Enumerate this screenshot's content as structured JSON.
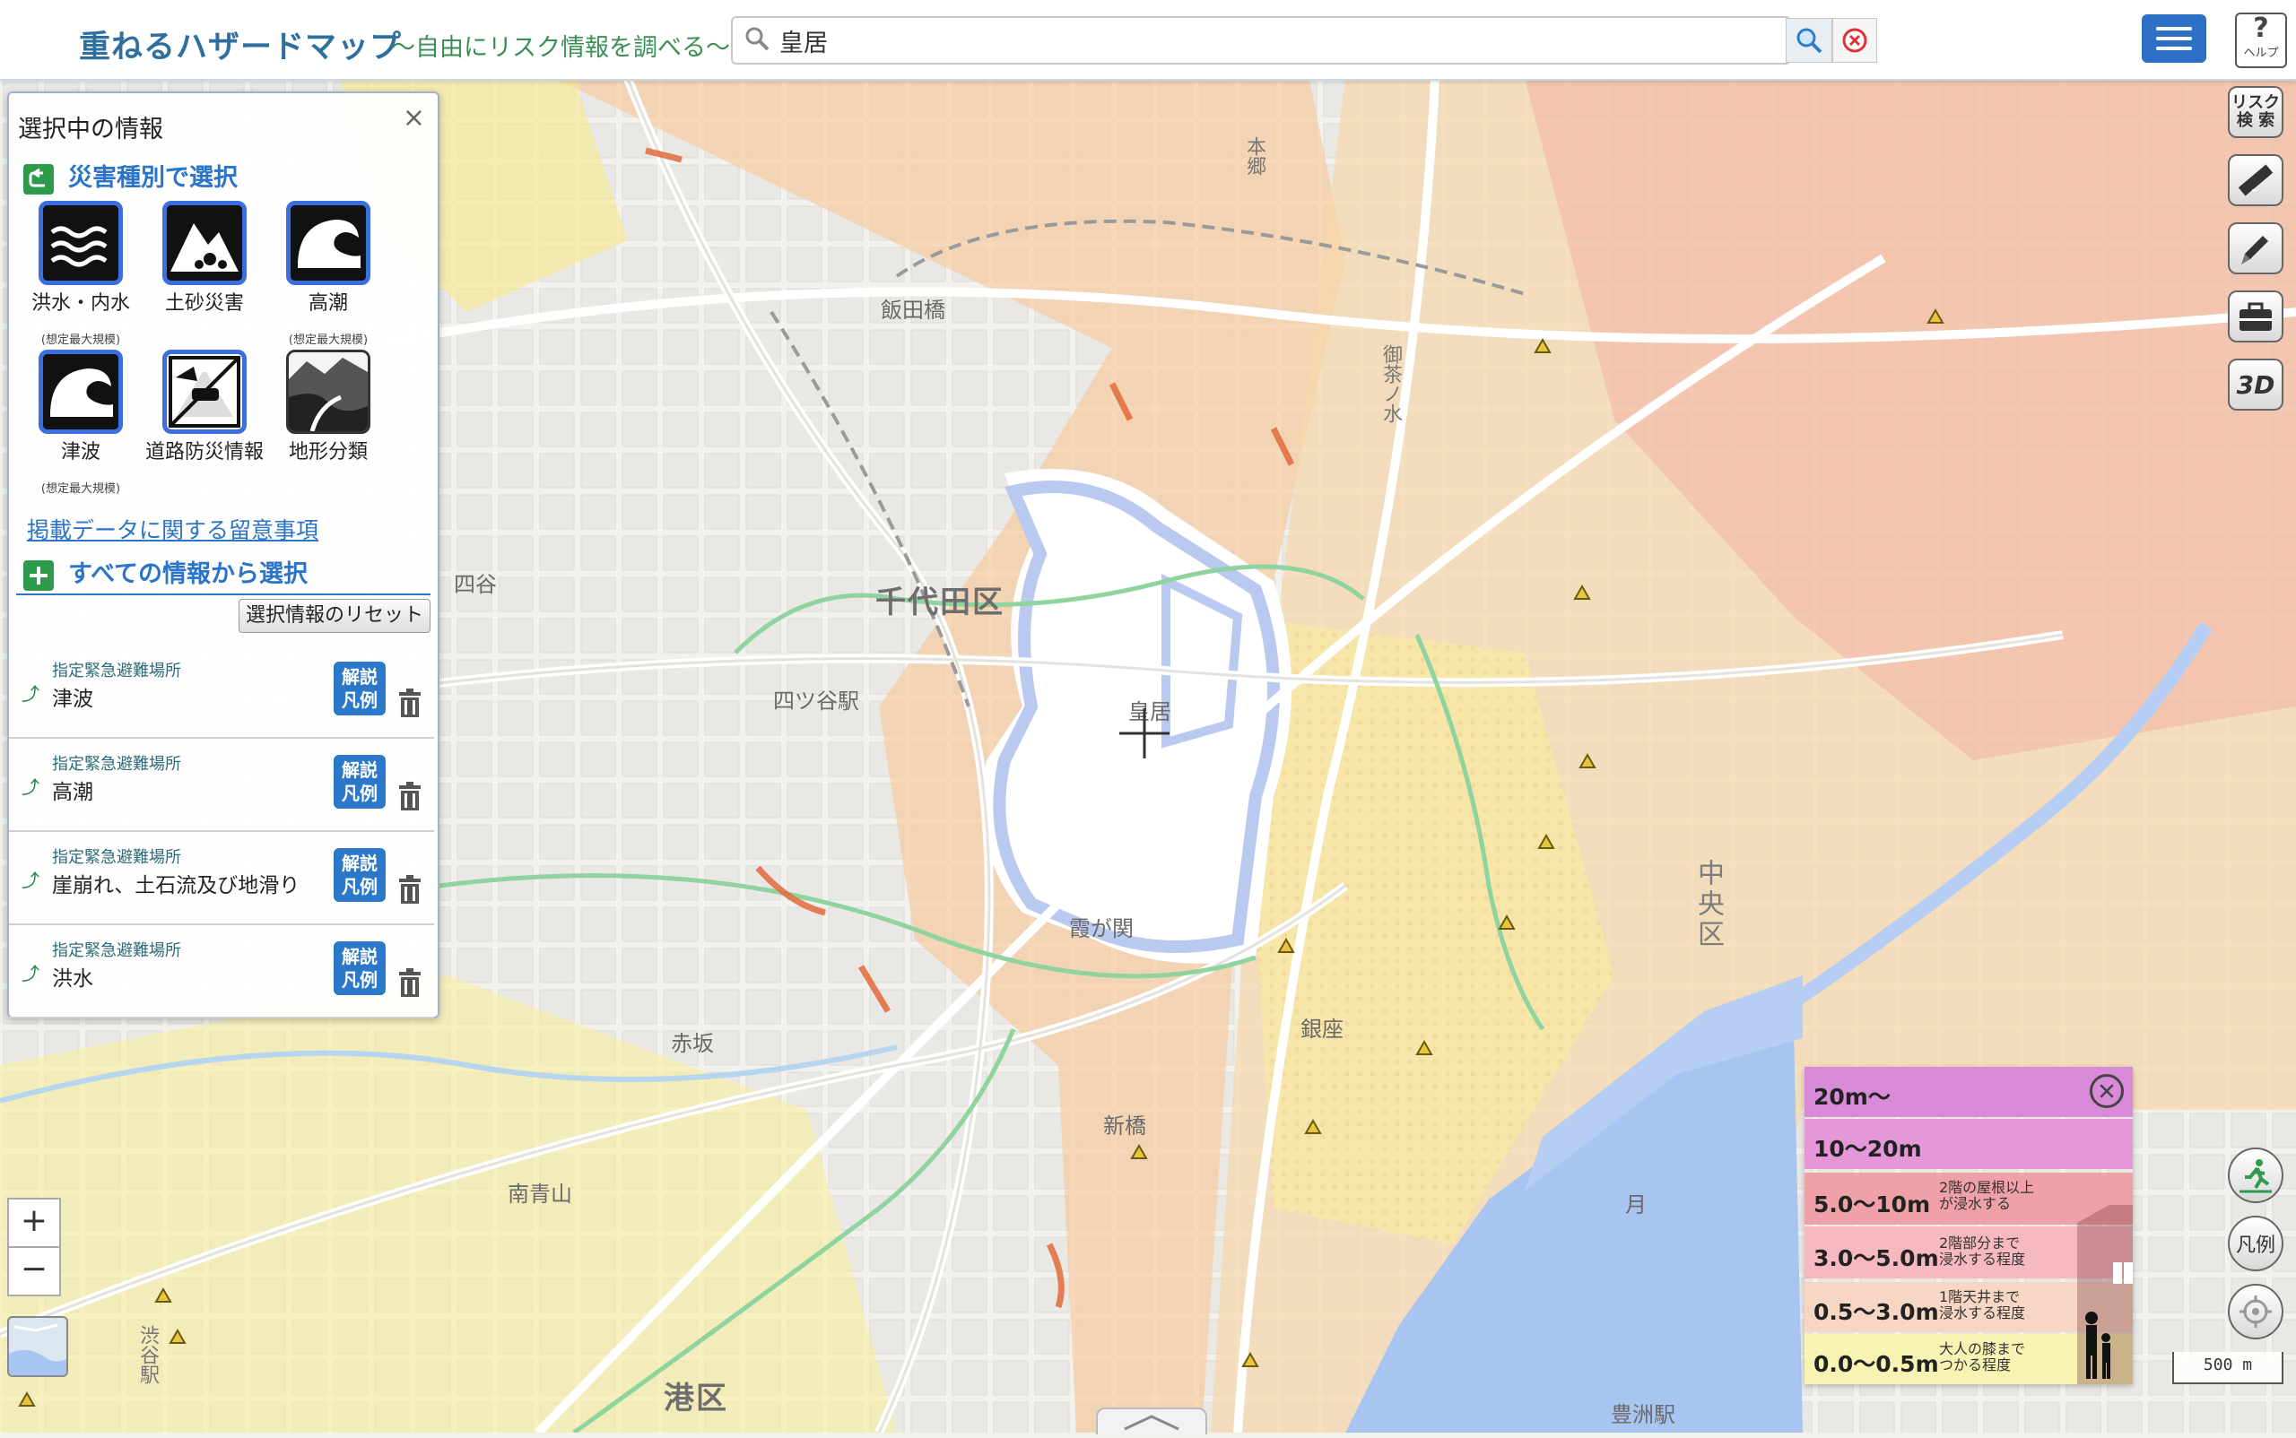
{
  "header": {
    "title": "重ねるハザードマップ",
    "subtitle": "〜自由にリスク情報を調べる〜",
    "search_value": "皇居",
    "help_label": "ヘルプ",
    "help_symbol": "?"
  },
  "panel": {
    "title": "選択中の情報",
    "close_symbol": "×",
    "by_type_heading": "災害種別で選択",
    "hazards": [
      {
        "label": "洪水・内水",
        "note": "(想定最大規模)"
      },
      {
        "label": "土砂災害",
        "note": ""
      },
      {
        "label": "高潮",
        "note": "(想定最大規模)"
      },
      {
        "label": "津波",
        "note": "(想定最大規模)"
      },
      {
        "label": "道路防災情報",
        "note": ""
      },
      {
        "label": "地形分類",
        "note": ""
      }
    ],
    "notes_link": "掲載データに関する留意事項",
    "all_info_heading": "すべての情報から選択",
    "reset_label": "選択情報のリセット",
    "legend_button_line1": "解説",
    "legend_button_line2": "凡例",
    "layers": [
      {
        "category": "指定緊急避難場所",
        "name": "津波"
      },
      {
        "category": "指定緊急避難場所",
        "name": "高潮"
      },
      {
        "category": "指定緊急避難場所",
        "name": "崖崩れ、土石流及び地滑り"
      },
      {
        "category": "指定緊急避難場所",
        "name": "洪水"
      }
    ]
  },
  "toolbar": {
    "risk_search_line1": "リスク",
    "risk_search_line2": "検 索",
    "threed_label": "3D",
    "legend_label": "凡例"
  },
  "zoom": {
    "in": "+",
    "out": "−"
  },
  "depth_legend": {
    "rows": [
      {
        "value": "20m〜",
        "desc": "",
        "color": "#d98ad8"
      },
      {
        "value": "10〜20m",
        "desc": "",
        "color": "#e597d8"
      },
      {
        "value": "5.0〜10m",
        "desc": "2階の屋根以上\nが浸水する",
        "color": "#f0a1a8"
      },
      {
        "value": "3.0〜5.0m",
        "desc": "2階部分まで\n浸水する程度",
        "color": "#f6b9c2"
      },
      {
        "value": "0.5〜3.0m",
        "desc": "1階天井まで\n浸水する程度",
        "color": "#f7d6c4"
      },
      {
        "value": "0.0〜0.5m",
        "desc": "大人の膝まで\nつかる程度",
        "color": "#f8f3b3"
      }
    ]
  },
  "scale": {
    "label": "500 m"
  },
  "map": {
    "labels": {
      "chiyoda": "千代田区",
      "kokyo": "皇居",
      "yotsuya": "四ツ谷駅",
      "iidabashi": "飯田橋",
      "hongo": "本郷",
      "ochanomizu": "御茶ノ水",
      "kasumigaseki": "霞が関",
      "shinbashi": "新橋",
      "akasaka": "赤坂",
      "minamiaoyama": "南青山",
      "yotsuya_ward": "四谷",
      "chuo": "中央区",
      "minato": "港区",
      "shibuya": "渋谷駅",
      "toyosu": "豊洲駅",
      "ginza": "銀座",
      "kachidoki": "月"
    }
  }
}
